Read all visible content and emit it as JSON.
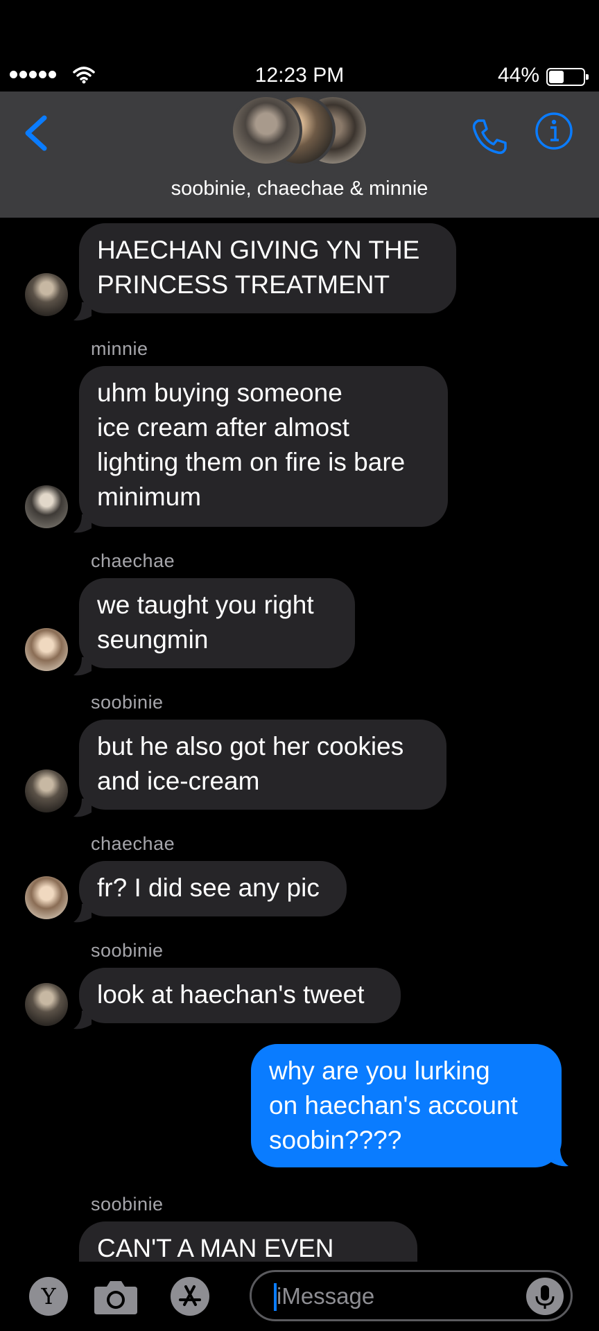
{
  "status": {
    "time": "12:23 PM",
    "battery": "44%",
    "battery_level": 0.44
  },
  "header": {
    "title": "soobinie, chaechae  & minnie",
    "icons": {
      "back": "chevron-left-icon",
      "phone": "phone-icon",
      "info": "info-icon"
    },
    "accent": "#0a7cff"
  },
  "messages": [
    {
      "sender": "",
      "text": "HAECHAN GIVING YN THE\nPRINCESS TREATMENT"
    },
    {
      "sender": "minnie",
      "text": "uhm buying someone\nice cream after almost\nlighting them on fire is bare\nminimum"
    },
    {
      "sender": "chaechae",
      "text": "we taught you right\nseungmin"
    },
    {
      "sender": "soobinie",
      "text": "but he also got her cookies\nand ice-cream"
    },
    {
      "sender": "chaechae",
      "text": "fr? I did see any pic"
    },
    {
      "sender": "soobinie",
      "text": "look at haechan's tweet"
    },
    {
      "sender": "",
      "text": "why are you lurking\non haechan's account\nsoobin????"
    },
    {
      "sender": "soobinie",
      "text": "CAN'T A MAN EVEN"
    }
  ],
  "composer": {
    "placeholder": "iMessage",
    "y_label": "Y"
  }
}
